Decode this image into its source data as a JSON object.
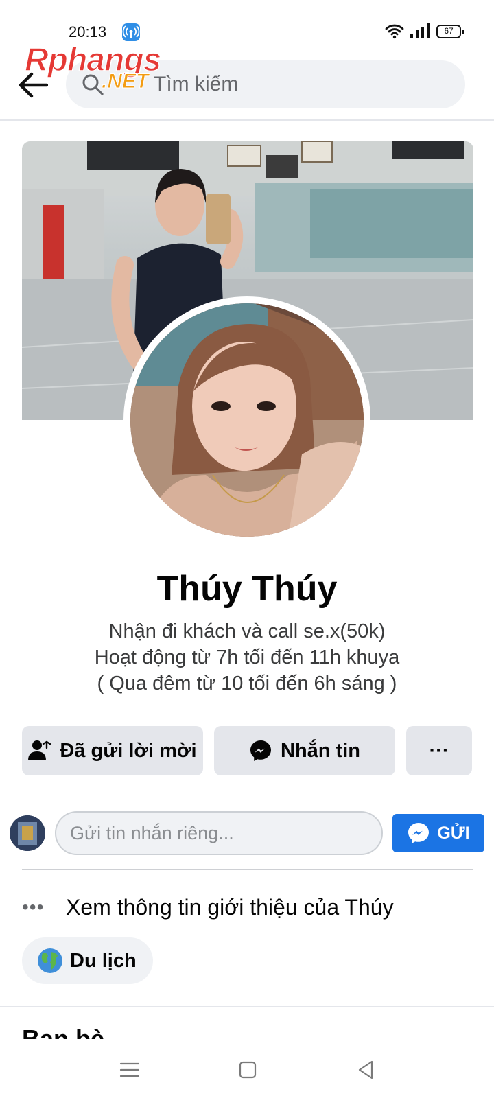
{
  "status_bar": {
    "time": "20:13",
    "battery": "67"
  },
  "watermark": {
    "main": "Rphangs",
    "sub": ".NET"
  },
  "search": {
    "placeholder": "Tìm kiếm"
  },
  "profile": {
    "name": "Thúy Thúy",
    "bio": [
      "Nhận đi khách và call se.x(50k)",
      "Hoạt động từ 7h tối đến 11h khuya",
      "( Qua đêm từ 10 tối đến 6h sáng )"
    ]
  },
  "actions": {
    "friend_request": "Đã gửi lời mời",
    "message": "Nhắn tin",
    "more": "···"
  },
  "message_row": {
    "placeholder": "Gửi tin nhắn riêng...",
    "send_label": "GỬI"
  },
  "intro": {
    "see_about": "Xem thông tin giới thiệu của Thúy",
    "hobby_chip": "Du lịch"
  },
  "next_section": {
    "peek_text": "Bạn bè"
  },
  "colors": {
    "accent": "#1b74e4",
    "button_bg": "#e4e6eb",
    "field_bg": "#f0f2f5"
  },
  "icons": [
    "back-arrow",
    "search",
    "user-check",
    "messenger",
    "more",
    "globe",
    "menu",
    "home",
    "back"
  ]
}
